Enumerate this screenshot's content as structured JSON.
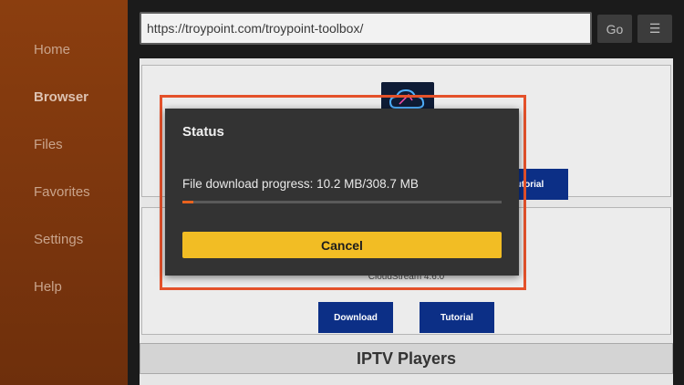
{
  "sidebar": {
    "items": [
      {
        "label": "Home",
        "active": false
      },
      {
        "label": "Browser",
        "active": true
      },
      {
        "label": "Files",
        "active": false
      },
      {
        "label": "Favorites",
        "active": false
      },
      {
        "label": "Settings",
        "active": false
      },
      {
        "label": "Help",
        "active": false
      }
    ]
  },
  "toolbar": {
    "url": "https://troypoint.com/troypoint-toolbox/",
    "go_label": "Go",
    "menu_icon": "☰"
  },
  "page": {
    "card1": {
      "button_partial_label": "utorial"
    },
    "card2": {
      "app_version": "CloudStream 4.6.0",
      "download_label": "Download",
      "tutorial_label": "Tutorial"
    },
    "section_title": "IPTV Players"
  },
  "dialog": {
    "title": "Status",
    "progress_text": "File download progress: 10.2 MB/308.7 MB",
    "progress_fraction": 0.033,
    "cancel_label": "Cancel"
  },
  "colors": {
    "accent": "#f2bd24",
    "progress": "#e8621e",
    "highlight": "#e4512a",
    "sidebar": "#8b3e0f",
    "blue_button": "#0c2f86"
  }
}
